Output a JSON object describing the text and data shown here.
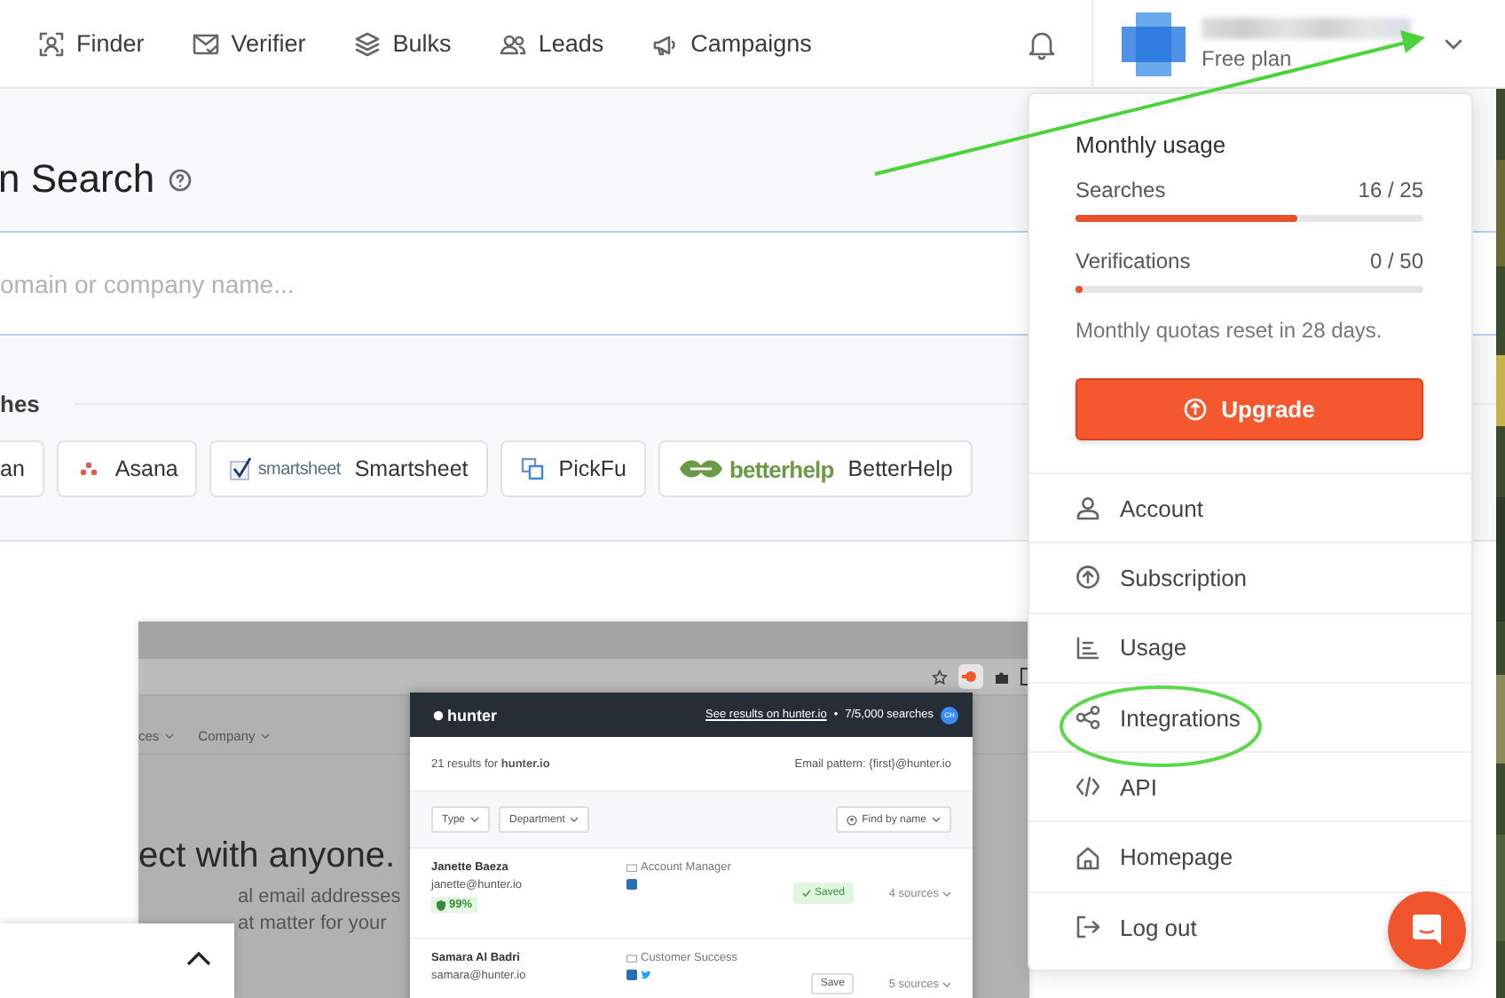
{
  "nav": {
    "items": [
      {
        "label": "Finder",
        "kind": "finder"
      },
      {
        "label": "Verifier",
        "kind": "verifier"
      },
      {
        "label": "Bulks",
        "kind": "bulks"
      },
      {
        "label": "Leads",
        "kind": "leads"
      },
      {
        "label": "Campaigns",
        "kind": "campaigns"
      }
    ]
  },
  "user": {
    "plan": "Free plan"
  },
  "page": {
    "title": "n Search",
    "search": {
      "placeholder": "omain or company name..."
    },
    "recent_label": "hes",
    "recent": [
      {
        "name": "an",
        "kind": "none"
      },
      {
        "name": "Asana",
        "kind": "asana"
      },
      {
        "name": "Smartsheet",
        "kind": "smartsheet",
        "logo_text": "smartsheet"
      },
      {
        "name": "PickFu",
        "kind": "pickfu"
      },
      {
        "name": "BetterHelp",
        "kind": "betterhelp",
        "logo_text": "betterhelp"
      }
    ]
  },
  "preview": {
    "site_nav": [
      "ces",
      "Company"
    ],
    "headline": "ect with anyone.",
    "lines": [
      "al email addresses",
      "at matter for your"
    ],
    "extension": {
      "brand": "hunter",
      "link": "See results on hunter.io",
      "separator": "•",
      "quota": "7/5,000 searches",
      "avatar": "CH",
      "summary": "21 results for **hunter.io**",
      "pattern": "Email pattern: {first}@hunter.io",
      "filters": [
        "Type",
        "Department"
      ],
      "find": "Find by name",
      "people": [
        {
          "name": "Janette Baeza",
          "email": "janette@hunter.io",
          "score": "99%",
          "role": "Account Manager",
          "action": "Saved",
          "saved": true,
          "sources": "4 sources"
        },
        {
          "name": "Samara Al Badri",
          "email": "samara@hunter.io",
          "role": "Customer Success",
          "action": "Save",
          "saved": false,
          "sources": "5 sources"
        }
      ]
    }
  },
  "menu": {
    "heading": "Monthly usage",
    "meters": [
      {
        "label": "Searches",
        "reading": "16 / 25",
        "level": 0.64
      },
      {
        "label": "Verifications",
        "reading": "0 / 50",
        "level": 0
      }
    ],
    "note": "Monthly quotas reset in 28 days.",
    "upgrade": "Upgrade",
    "items": [
      {
        "label": "Account",
        "kind": "account"
      },
      {
        "label": "Subscription",
        "kind": "subscription"
      },
      {
        "label": "Usage",
        "kind": "usage"
      },
      {
        "label": "Integrations",
        "kind": "integrations"
      },
      {
        "label": "API",
        "kind": "api"
      },
      {
        "label": "Homepage",
        "kind": "homepage"
      },
      {
        "label": "Log out",
        "kind": "logout"
      }
    ]
  }
}
